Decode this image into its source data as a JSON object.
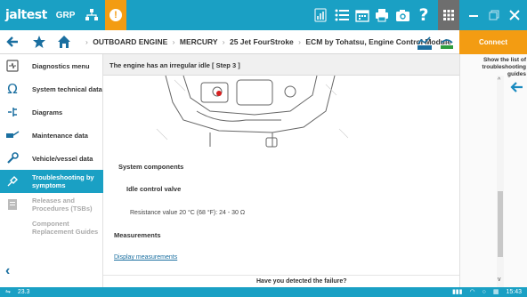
{
  "brand": {
    "logo_text": "jaltest",
    "group_label": "GRP"
  },
  "colors": {
    "accent": "#1aa0c4",
    "orange": "#f39c12",
    "active_item": "#1aa0c4"
  },
  "breadcrumb": {
    "items": [
      "OUTBOARD ENGINE",
      "MERCURY",
      "25 Jet FourStroke",
      "ECM by Tohatsu, Engine Control Module"
    ]
  },
  "connect_label": "Connect",
  "right_panel": {
    "hint": "Show the list of troubleshooting guides"
  },
  "sidebar": {
    "items": [
      {
        "label": "Diagnostics menu",
        "icon": "diagnostics-icon"
      },
      {
        "label": "System technical data",
        "icon": "ohm-icon"
      },
      {
        "label": "Diagrams",
        "icon": "diagrams-icon"
      },
      {
        "label": "Maintenance data",
        "icon": "maintenance-icon"
      },
      {
        "label": "Vehicle/vessel data",
        "icon": "wrench-icon"
      },
      {
        "label": "Troubleshooting by symptoms",
        "icon": "troubleshooting-icon"
      },
      {
        "label": "Releases and Procedures (TSBs)",
        "icon": "document-icon"
      },
      {
        "label": "Component Replacement Guides",
        "icon": ""
      }
    ]
  },
  "content": {
    "header": "The engine has an irregular idle [ Step 3 ]",
    "system_components_title": "System components",
    "component_name": "Idle control valve",
    "resistance_text": "Resistance value 20 °C (68 °F): 24 - 30 Ω",
    "measurements_title": "Measurements",
    "display_measurements_link": "Display measurements",
    "failure_question": "Have you detected the failure?"
  },
  "status": {
    "left_value": "23.3",
    "time": "15:43"
  }
}
